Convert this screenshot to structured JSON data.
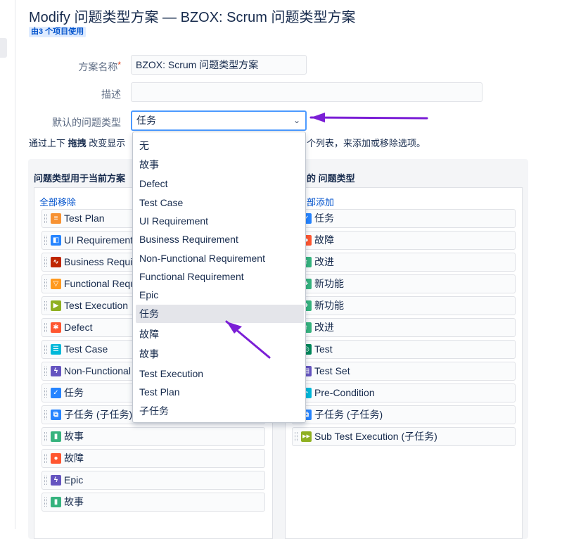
{
  "header": {
    "title": "Modify 问题类型方案 — BZOX: Scrum 问题类型方案",
    "usage_badge": "由3 个项目使用"
  },
  "form": {
    "name_label": "方案名称",
    "name_required_mark": "*",
    "name_value": "BZOX: Scrum 问题类型方案",
    "desc_label": "描述",
    "desc_value": "",
    "default_label": "默认的问题类型",
    "default_value": "任务",
    "default_chevron": "chevron-down-icon"
  },
  "help": {
    "prefix": "通过上下 ",
    "bold": "拖拽",
    "suffix": " 改变显示",
    "tail": "个列表，来添加或移除选项。"
  },
  "left_panel": {
    "title": "问题类型用于当前方案",
    "action": "全部移除",
    "items": [
      {
        "label": "Test Plan",
        "icon": "test-plan-icon",
        "color": "#f79232",
        "glyph": "≡"
      },
      {
        "label": "UI Requirement",
        "icon": "ui-requirement-icon",
        "color": "#2684ff",
        "glyph": "◧"
      },
      {
        "label": "Business Requirement",
        "icon": "business-requirement-icon",
        "color": "#bf2600",
        "glyph": "∿"
      },
      {
        "label": "Functional Requirement",
        "icon": "functional-requirement-icon",
        "color": "#ff991f",
        "glyph": "▽"
      },
      {
        "label": "Test Execution",
        "icon": "test-execution-icon",
        "color": "#8fb021",
        "glyph": "▶"
      },
      {
        "label": "Defect",
        "icon": "defect-icon",
        "color": "#ff5630",
        "glyph": "✱"
      },
      {
        "label": "Test Case",
        "icon": "test-case-icon",
        "color": "#00b8d9",
        "glyph": "☰"
      },
      {
        "label": "Non-Functional Requirement",
        "icon": "non-functional-requirement-icon",
        "color": "#6554c0",
        "glyph": "ϟ"
      },
      {
        "label": "任务",
        "icon": "task-icon",
        "color": "#2684ff",
        "glyph": "✓"
      },
      {
        "label": "子任务 (子任务)",
        "icon": "subtask-icon",
        "color": "#2684ff",
        "glyph": "⧉"
      },
      {
        "label": "故事",
        "icon": "story-icon",
        "color": "#36b37e",
        "glyph": "▮"
      },
      {
        "label": "故障",
        "icon": "bug-icon",
        "color": "#ff5630",
        "glyph": "●"
      },
      {
        "label": "Epic",
        "icon": "epic-icon",
        "color": "#6554c0",
        "glyph": "ϟ"
      },
      {
        "label": "故事",
        "icon": "story-icon",
        "color": "#36b37e",
        "glyph": "▮"
      }
    ]
  },
  "right_panel": {
    "title": "的 问题类型",
    "action": "部添加",
    "items": [
      {
        "label": "任务",
        "icon": "task-icon",
        "color": "#2684ff",
        "glyph": "✓"
      },
      {
        "label": "故障",
        "icon": "bug-icon",
        "color": "#ff5630",
        "glyph": "●"
      },
      {
        "label": "改进",
        "icon": "improvement-icon",
        "color": "#36b37e",
        "glyph": "↑"
      },
      {
        "label": "新功能",
        "icon": "new-feature-icon",
        "color": "#36b37e",
        "glyph": "+"
      },
      {
        "label": "新功能",
        "icon": "new-feature-icon",
        "color": "#36b37e",
        "glyph": "+"
      },
      {
        "label": "改进",
        "icon": "improvement-icon",
        "color": "#36b37e",
        "glyph": "↑"
      },
      {
        "label": "Test",
        "icon": "test-icon",
        "color": "#00875a",
        "glyph": "◎"
      },
      {
        "label": "Test Set",
        "icon": "test-set-icon",
        "color": "#6554c0",
        "glyph": "▤"
      },
      {
        "label": "Pre-Condition",
        "icon": "pre-condition-icon",
        "color": "#00b8d9",
        "glyph": "◔"
      },
      {
        "label": "子任务 (子任务)",
        "icon": "subtask-icon",
        "color": "#2684ff",
        "glyph": "⧉"
      },
      {
        "label": "Sub Test Execution (子任务)",
        "icon": "sub-test-execution-icon",
        "color": "#8fb021",
        "glyph": "▶▶"
      }
    ]
  },
  "dropdown": {
    "options": [
      "无",
      "故事",
      "Defect",
      "Test Case",
      "UI Requirement",
      "Business Requirement",
      "Non-Functional Requirement",
      "Functional Requirement",
      "Epic",
      "任务",
      "故障",
      "故事",
      "Test Execution",
      "Test Plan",
      "子任务"
    ],
    "selected_index": 9
  },
  "colors": {
    "annotation_arrow": "#7b1fd6",
    "link": "#0052cc",
    "focus_border": "#4c9aff"
  }
}
